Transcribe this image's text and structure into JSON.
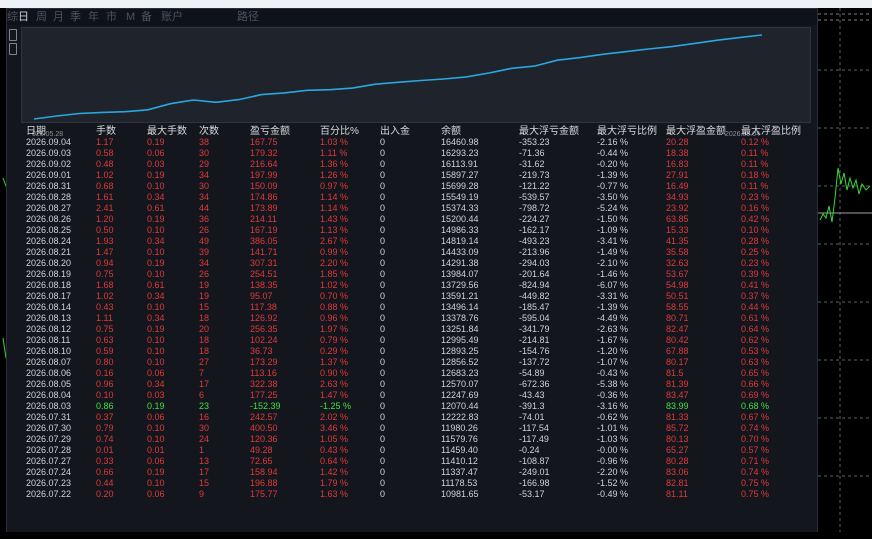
{
  "menu": [
    "综",
    "日",
    "周",
    "月",
    "季",
    "年",
    "市",
    "M",
    "备",
    "账户",
    "路径"
  ],
  "left_letters": [
    "日",
    "D",
    "D"
  ],
  "curve": {
    "start_label": "026.05.28",
    "end_label": "2026.09.04",
    "line_color": "#29a8e0",
    "values": [
      10981.65,
      11178.53,
      11337.47,
      11410.12,
      11459.4,
      11579.76,
      11980.26,
      12222.83,
      12070.44,
      12247.69,
      12570.07,
      12683.23,
      12856.52,
      12893.25,
      12995.49,
      13251.84,
      13378.76,
      13496.14,
      13591.21,
      13729.56,
      13984.07,
      14291.38,
      14433.09,
      14819.14,
      14986.33,
      15200.44,
      15374.33,
      15549.19,
      15699.28,
      15897.27,
      16113.91,
      16293.23,
      16460.98
    ]
  },
  "table": {
    "headers": [
      "日期",
      "手数",
      "最大手数",
      "次数",
      "盈亏金额",
      "百分比%",
      "出入金",
      "余额",
      "最大浮亏金额",
      "最大浮亏比例",
      "最大浮盈金额",
      "最大浮盈比例"
    ],
    "rows": [
      [
        "2026.09.04",
        "1.17",
        "0.19",
        "38",
        "167.75",
        "1.03 %",
        "0",
        "16460.98",
        "-353.23",
        "-2.16 %",
        "20.28",
        "0.12 %"
      ],
      [
        "2026.09.03",
        "0.58",
        "0.06",
        "30",
        "179.32",
        "1.11 %",
        "0",
        "16293.23",
        "-71.36",
        "-0.44 %",
        "18.38",
        "0.11 %"
      ],
      [
        "2026.09.02",
        "0.48",
        "0.03",
        "29",
        "216.64",
        "1.36 %",
        "0",
        "16113.91",
        "-31.62",
        "-0.20 %",
        "16.83",
        "0.11 %"
      ],
      [
        "2026.09.01",
        "1.02",
        "0.19",
        "34",
        "197.99",
        "1.26 %",
        "0",
        "15897.27",
        "-219.73",
        "-1.39 %",
        "27.91",
        "0.18 %"
      ],
      [
        "2026.08.31",
        "0.68",
        "0.10",
        "30",
        "150.09",
        "0.97 %",
        "0",
        "15699.28",
        "-121.22",
        "-0.77 %",
        "16.49",
        "0.11 %"
      ],
      [
        "2026.08.28",
        "1.61",
        "0.34",
        "34",
        "174.86",
        "1.14 %",
        "0",
        "15549.19",
        "-539.57",
        "-3.50 %",
        "34.93",
        "0.23 %"
      ],
      [
        "2026.08.27",
        "2.41",
        "0.61",
        "44",
        "173.89",
        "1.14 %",
        "0",
        "15374.33",
        "-798.72",
        "-5.24 %",
        "23.92",
        "0.16 %"
      ],
      [
        "2026.08.26",
        "1.20",
        "0.19",
        "36",
        "214.11",
        "1.43 %",
        "0",
        "15200.44",
        "-224.27",
        "-1.50 %",
        "63.85",
        "0.42 %"
      ],
      [
        "2026.08.25",
        "0.50",
        "0.10",
        "26",
        "167.19",
        "1.13 %",
        "0",
        "14986.33",
        "-162.17",
        "-1.09 %",
        "15.33",
        "0.10 %"
      ],
      [
        "2026.08.24",
        "1.93",
        "0.34",
        "49",
        "386.05",
        "2.67 %",
        "0",
        "14819.14",
        "-493.23",
        "-3.41 %",
        "41.35",
        "0.28 %"
      ],
      [
        "2026.08.21",
        "1.47",
        "0.10",
        "39",
        "141.71",
        "0.99 %",
        "0",
        "14433.09",
        "-213.96",
        "-1.49 %",
        "35.58",
        "0.25 %"
      ],
      [
        "2026.08.20",
        "0.94",
        "0.19",
        "34",
        "307.31",
        "2.20 %",
        "0",
        "14291.38",
        "-294.03",
        "-2.10 %",
        "32.63",
        "0.23 %"
      ],
      [
        "2026.08.19",
        "0.75",
        "0.10",
        "26",
        "254.51",
        "1.85 %",
        "0",
        "13984.07",
        "-201.64",
        "-1.46 %",
        "53.67",
        "0.39 %"
      ],
      [
        "2026.08.18",
        "1.68",
        "0.61",
        "19",
        "138.35",
        "1.02 %",
        "0",
        "13729.56",
        "-824.94",
        "-6.07 %",
        "54.98",
        "0.41 %"
      ],
      [
        "2026.08.17",
        "1.02",
        "0.34",
        "19",
        "95.07",
        "0.70 %",
        "0",
        "13591.21",
        "-449.82",
        "-3.31 %",
        "50.51",
        "0.37 %"
      ],
      [
        "2026.08.14",
        "0.43",
        "0.10",
        "15",
        "117.38",
        "0.88 %",
        "0",
        "13496.14",
        "-185.47",
        "-1.39 %",
        "58.55",
        "0.44 %"
      ],
      [
        "2026.08.13",
        "1.11",
        "0.34",
        "18",
        "126.92",
        "0.96 %",
        "0",
        "13378.76",
        "-595.04",
        "-4.49 %",
        "80.71",
        "0.61 %"
      ],
      [
        "2026.08.12",
        "0.75",
        "0.19",
        "20",
        "256.35",
        "1.97 %",
        "0",
        "13251.84",
        "-341.79",
        "-2.63 %",
        "82.47",
        "0.64 %"
      ],
      [
        "2026.08.11",
        "0.63",
        "0.10",
        "18",
        "102.24",
        "0.79 %",
        "0",
        "12995.49",
        "-214.81",
        "-1.67 %",
        "80.42",
        "0.62 %"
      ],
      [
        "2026.08.10",
        "0.59",
        "0.10",
        "18",
        "36.73",
        "0.29 %",
        "0",
        "12893.25",
        "-154.76",
        "-1.20 %",
        "67.88",
        "0.53 %"
      ],
      [
        "2026.08.07",
        "0.80",
        "0.10",
        "27",
        "173.29",
        "1.37 %",
        "0",
        "12856.52",
        "-137.72",
        "-1.07 %",
        "80.17",
        "0.63 %"
      ],
      [
        "2026.08.06",
        "0.16",
        "0.06",
        "7",
        "113.16",
        "0.90 %",
        "0",
        "12683.23",
        "-54.89",
        "-0.43 %",
        "81.5",
        "0.65 %"
      ],
      [
        "2026.08.05",
        "0.96",
        "0.34",
        "17",
        "322.38",
        "2.63 %",
        "0",
        "12570.07",
        "-672.36",
        "-5.38 %",
        "81.39",
        "0.66 %"
      ],
      [
        "2026.08.04",
        "0.10",
        "0.03",
        "6",
        "177.25",
        "1.47 %",
        "0",
        "12247.69",
        "-43.43",
        "-0.36 %",
        "83.47",
        "0.69 %"
      ],
      [
        "2026.08.03",
        "0.86",
        "0.19",
        "23",
        "-152.39",
        "-1.25 %",
        "0",
        "12070.44",
        "-391.3",
        "-3.16 %",
        "83.99",
        "0.68 %"
      ],
      [
        "2026.07.31",
        "0.37",
        "0.06",
        "16",
        "242.57",
        "2.02 %",
        "0",
        "12222.83",
        "-74.01",
        "-0.62 %",
        "81.33",
        "0.67 %"
      ],
      [
        "2026.07.30",
        "0.79",
        "0.10",
        "30",
        "400.50",
        "3.46 %",
        "0",
        "11980.26",
        "-117.54",
        "-1.01 %",
        "85.72",
        "0.74 %"
      ],
      [
        "2026.07.29",
        "0.74",
        "0.10",
        "24",
        "120.36",
        "1.05 %",
        "0",
        "11579.76",
        "-117.49",
        "-1.03 %",
        "80.13",
        "0.70 %"
      ],
      [
        "2026.07.28",
        "0.01",
        "0.01",
        "1",
        "49.28",
        "0.43 %",
        "0",
        "11459.40",
        "-0.24",
        "-0.00 %",
        "65.27",
        "0.57 %"
      ],
      [
        "2026.07.27",
        "0.33",
        "0.06",
        "13",
        "72.65",
        "0.64 %",
        "0",
        "11410.12",
        "-108.87",
        "-0.96 %",
        "80.28",
        "0.71 %"
      ],
      [
        "2026.07.24",
        "0.66",
        "0.19",
        "17",
        "158.94",
        "1.42 %",
        "0",
        "11337.47",
        "-249.01",
        "-2.20 %",
        "83.06",
        "0.74 %"
      ],
      [
        "2026.07.23",
        "0.44",
        "0.10",
        "15",
        "196.88",
        "1.79 %",
        "0",
        "11178.53",
        "-166.98",
        "-1.52 %",
        "82.81",
        "0.75 %"
      ],
      [
        "2026.07.22",
        "0.20",
        "0.06",
        "9",
        "175.77",
        "1.63 %",
        "0",
        "10981.65",
        "-53.17",
        "-0.49 %",
        "81.11",
        "0.75 %"
      ]
    ]
  }
}
